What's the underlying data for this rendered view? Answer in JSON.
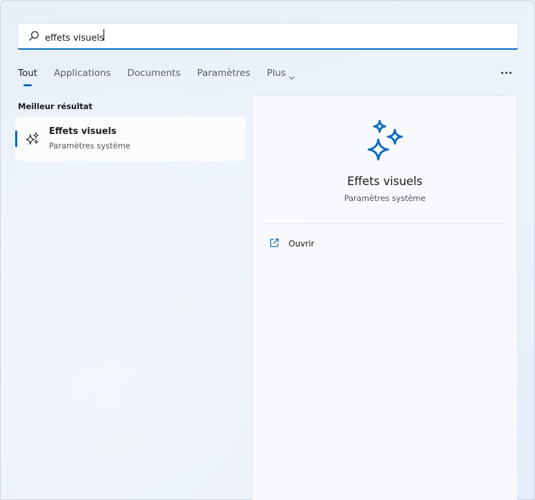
{
  "search": {
    "value": "effets visuels",
    "icon": "search-icon"
  },
  "tabs": [
    {
      "label": "Tout",
      "active": true
    },
    {
      "label": "Applications",
      "active": false
    },
    {
      "label": "Documents",
      "active": false
    },
    {
      "label": "Paramètres",
      "active": false
    },
    {
      "label": "Plus",
      "active": false
    }
  ],
  "more_icon": "more-options-icon",
  "best_match": {
    "heading": "Meilleur résultat",
    "title": "Effets visuels",
    "subtitle": "Paramètres système",
    "icon": "sparkle-icon"
  },
  "detail": {
    "title": "Effets visuels",
    "subtitle": "Paramètres système",
    "icon": "sparkle-icon",
    "actions": [
      {
        "label": "Ouvrir",
        "icon": "open-external-icon"
      }
    ]
  },
  "colors": {
    "accent": "#0067c0",
    "icon_blue": "#0f6cbd"
  }
}
